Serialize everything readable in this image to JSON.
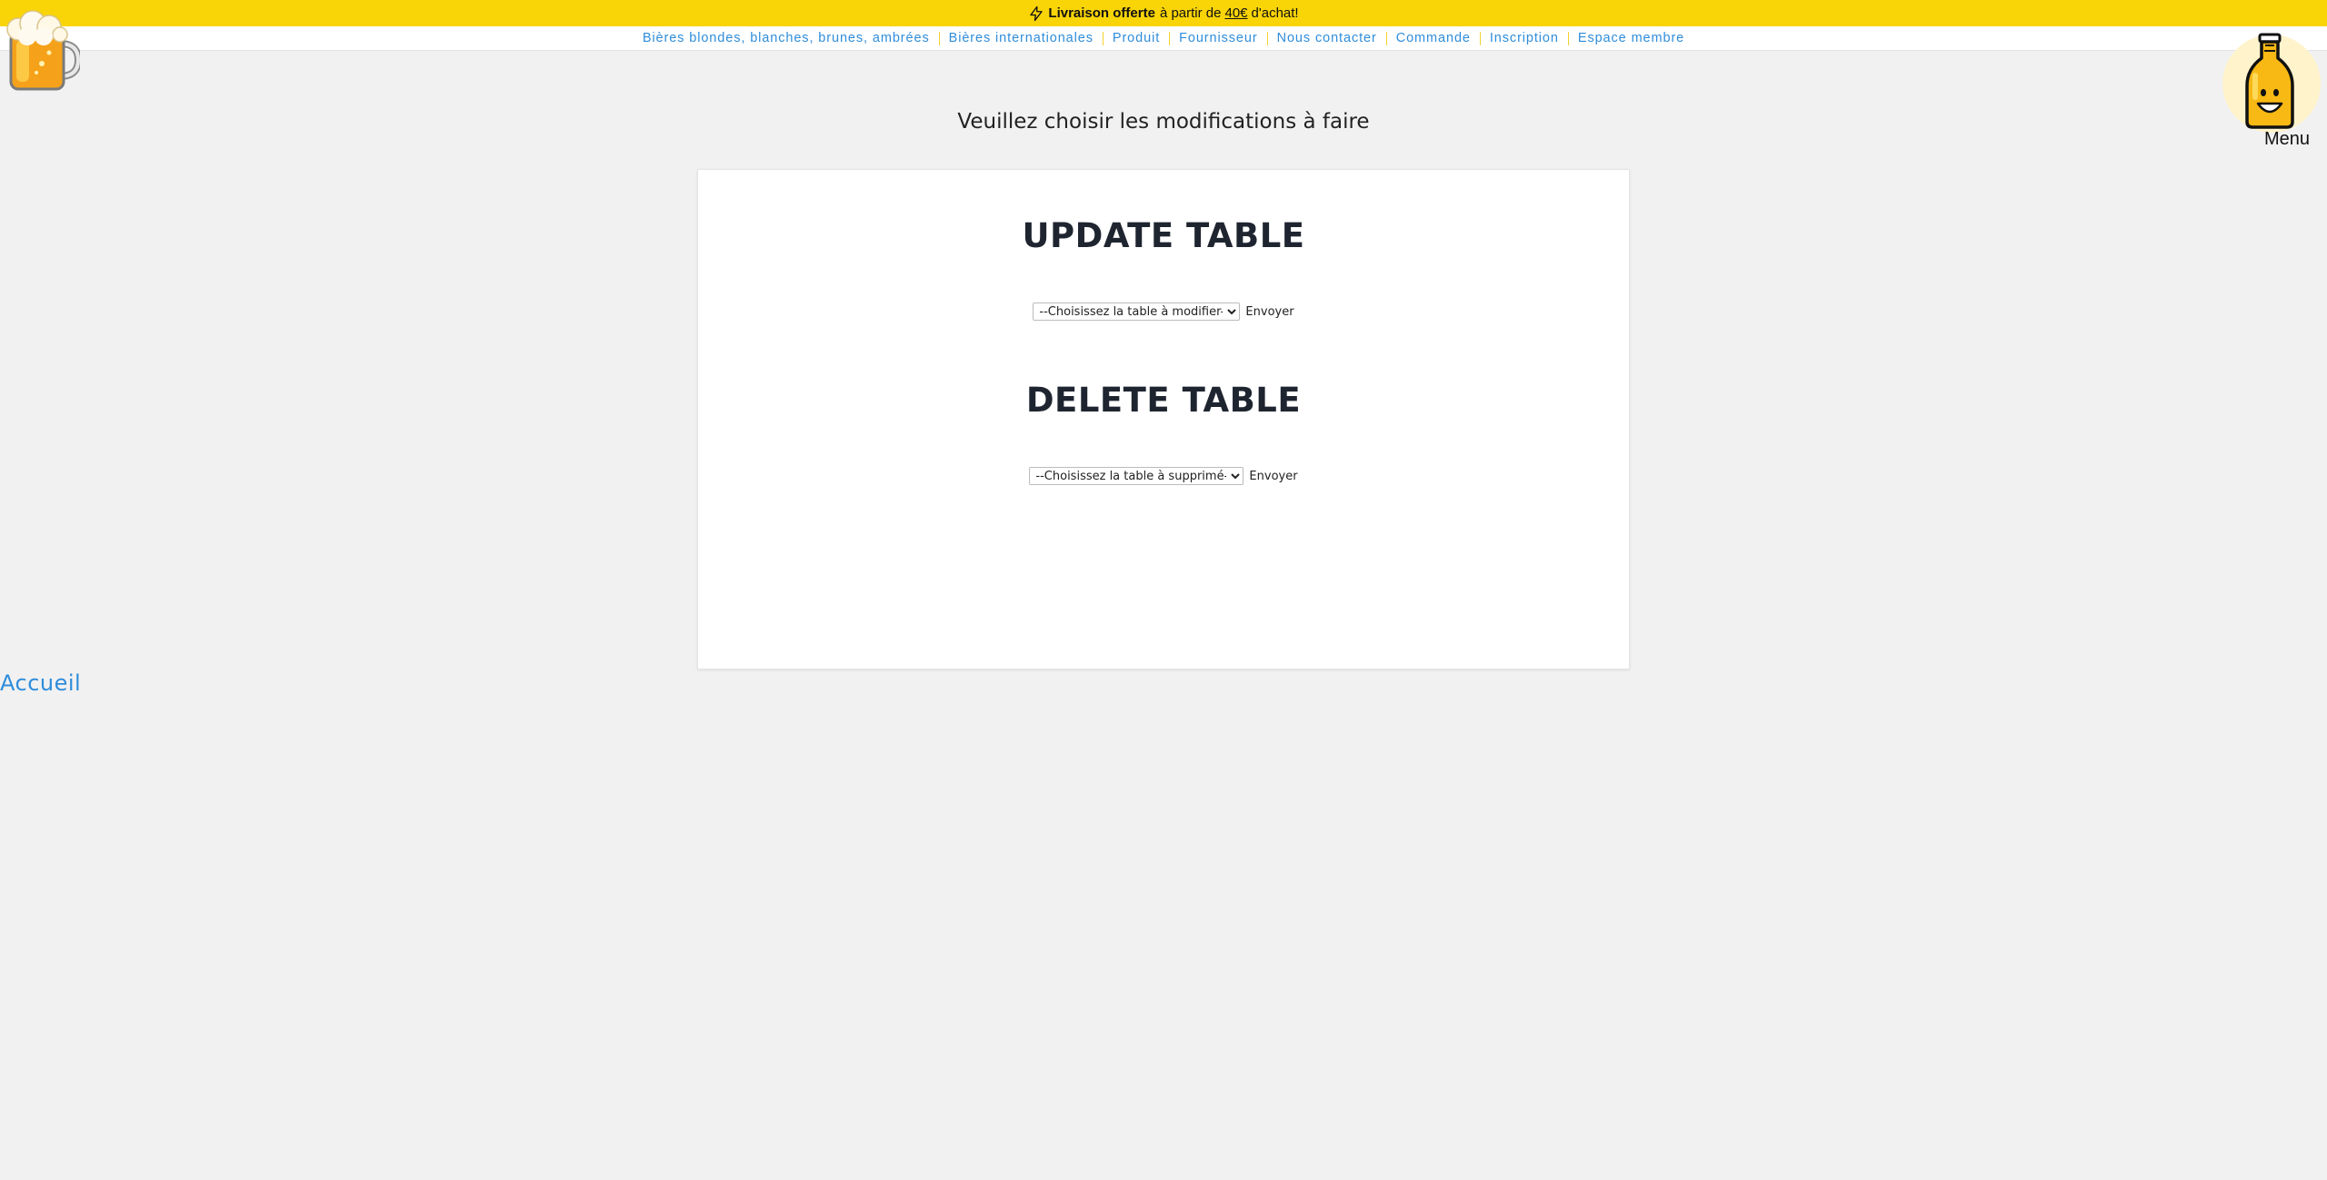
{
  "promo": {
    "bold": "Livraison offerte",
    "prefix": "à partir de",
    "amount": "40€",
    "suffix": "d'achat!",
    "icon": "lightning-icon"
  },
  "nav": {
    "items": [
      "Bières blondes, blanches, brunes, ambrées",
      "Bières internationales",
      "Produit",
      "Fournisseur",
      "Nous contacter",
      "Commande",
      "Inscription",
      "Espace membre"
    ]
  },
  "logo": {
    "icon": "beer-mug-logo"
  },
  "menu": {
    "label": "Menu",
    "icon": "beer-bottle-icon"
  },
  "page": {
    "heading": "Veuillez choisir les modifications à faire"
  },
  "update": {
    "title": "UPDATE TABLE",
    "select_value": "--Choisissez la table à modifier--",
    "submit_label": "Envoyer"
  },
  "delete": {
    "title": "DELETE TABLE",
    "select_value": "--Choisissez la table à supprimé--",
    "submit_label": "Envoyer"
  },
  "footer": {
    "home_link": "Accueil"
  },
  "colors": {
    "promo_bar": "#f9d406",
    "link": "#2f8ddb",
    "background": "#f1f1f1",
    "card": "#ffffff"
  }
}
